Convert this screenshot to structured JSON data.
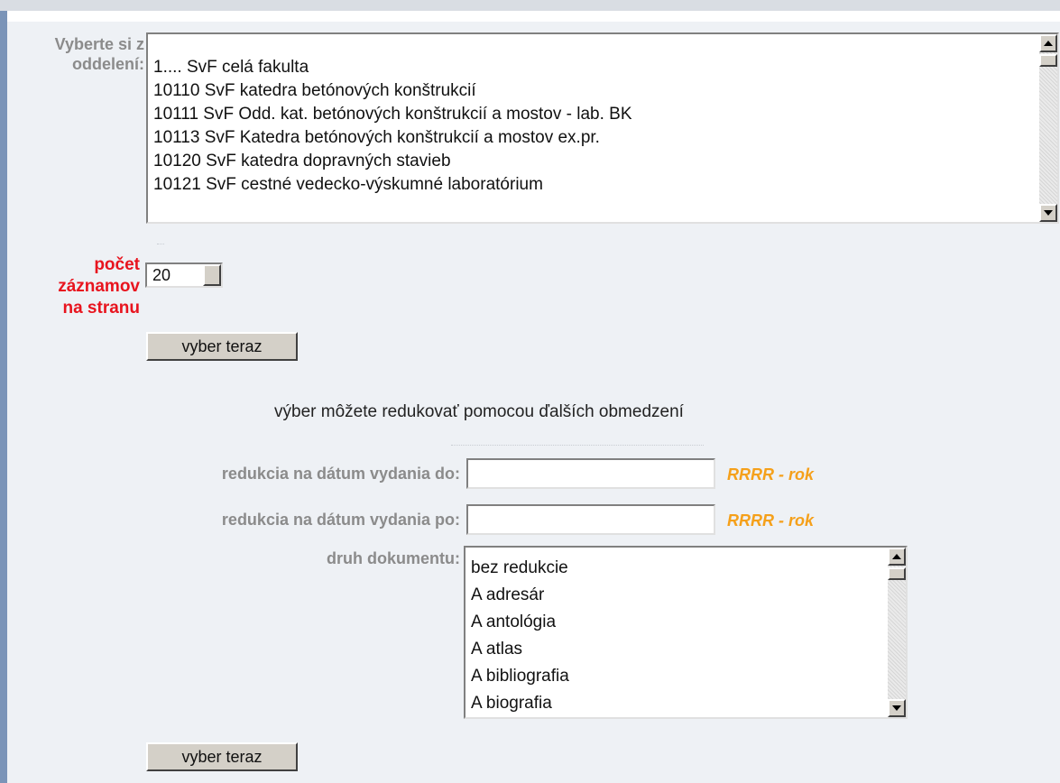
{
  "department_section": {
    "label": "Vyberte si z oddelení:",
    "departments": [
      "1.... SvF celá fakulta",
      "10110 SvF katedra betónových konštrukcií",
      "10111 SvF Odd. kat. betónových konštrukcií a mostov - lab. BK",
      "10113 SvF Katedra betónových konštrukcií a mostov ex.pr.",
      "10120 SvF katedra dopravných stavieb",
      "10121 SvF cestné vedecko-výskumné laboratórium"
    ]
  },
  "records_per_page": {
    "label_lines": [
      "počet",
      "záznamov",
      "na stranu"
    ],
    "selected": "20"
  },
  "submit_top": {
    "label": "vyber teraz"
  },
  "reduction_heading": "výber môžete redukovať pomocou ďalších obmedzení",
  "date_to": {
    "label": "redukcia na dátum vydania do:",
    "value": "",
    "hint": "RRRR - rok"
  },
  "date_from": {
    "label": "redukcia na dátum vydania po:",
    "value": "",
    "hint": "RRRR - rok"
  },
  "document_type": {
    "label": "druh dokumentu:",
    "options": [
      "bez redukcie",
      "A adresár",
      "A antológia",
      "A atlas",
      "A bibliografia",
      "A biografia"
    ]
  },
  "submit_bottom": {
    "label": "vyber teraz"
  }
}
